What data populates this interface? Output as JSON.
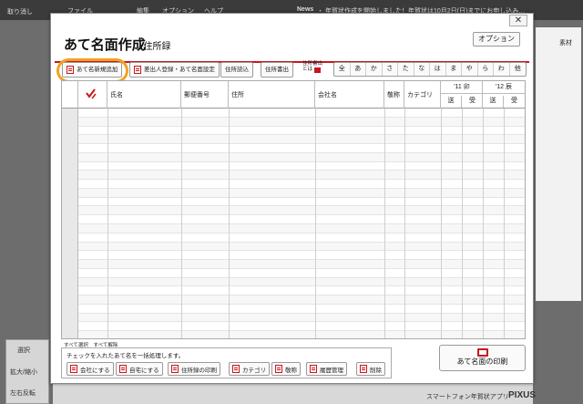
{
  "dialog": {
    "title": "あて名面作成",
    "subtitle": "/ 住所録",
    "close_glyph": "✕",
    "options_label": "オプション"
  },
  "toolbar": {
    "add_new_label": "あて名新規追加",
    "sender_label": "差出人登録・あて名面設定",
    "import_label": "住所読込",
    "export_label": "住所書出",
    "export_with_label_line1": "住所書出",
    "export_with_label_line2": "とは"
  },
  "kana_filters": [
    "全",
    "あ",
    "か",
    "さ",
    "た",
    "な",
    "は",
    "ま",
    "や",
    "ら",
    "わ",
    "他"
  ],
  "table": {
    "columns": {
      "check_icon": "check-mark",
      "name": "氏名",
      "postal": "郵便番号",
      "address": "住所",
      "company": "会社名",
      "honorific": "敬称",
      "category": "カテゴリ",
      "year11": "'11 卯",
      "year12": "'12 辰",
      "sent": "送",
      "received": "受"
    },
    "row_count": 26
  },
  "selection": {
    "select_all": "すべて選択",
    "deselect_all": "すべて解除",
    "bulk_label": "チェックを入れたあて名を一括処理します。"
  },
  "bulk_actions": [
    {
      "label": "会社にする",
      "icon": "building-icon"
    },
    {
      "label": "自宅にする",
      "icon": "home-icon"
    },
    {
      "label": "住所録の印刷",
      "icon": "print-list-icon"
    },
    {
      "label": "カテゴリ",
      "icon": "folder-icon"
    },
    {
      "label": "敬称",
      "icon": "tag-icon"
    },
    {
      "label": "履歴管理",
      "icon": "history-icon"
    },
    {
      "label": "削除",
      "icon": "trash-icon"
    }
  ],
  "print_button": {
    "label": "あて名面の印刷",
    "icon": "printer-icon"
  },
  "background": {
    "menu_file": "ファイル",
    "menu_edit": "編集",
    "menu_option": "オプション",
    "menu_help": "ヘルプ",
    "news": "News",
    "news_text": "・ 年賀状作成を開始しました！年賀状は10月2日(日)までにお申し込み…",
    "left_panel_1": "取り消し",
    "left_panel_2": "選択",
    "left_panel_3": "拡大/縮小",
    "left_panel_4": "左右反転",
    "right_label": "素材",
    "bottom_text": "スマートフォン年賀状アプリ",
    "brand": "PIXUS"
  },
  "colors": {
    "accent": "#c8171e",
    "highlight": "#f5a023"
  }
}
